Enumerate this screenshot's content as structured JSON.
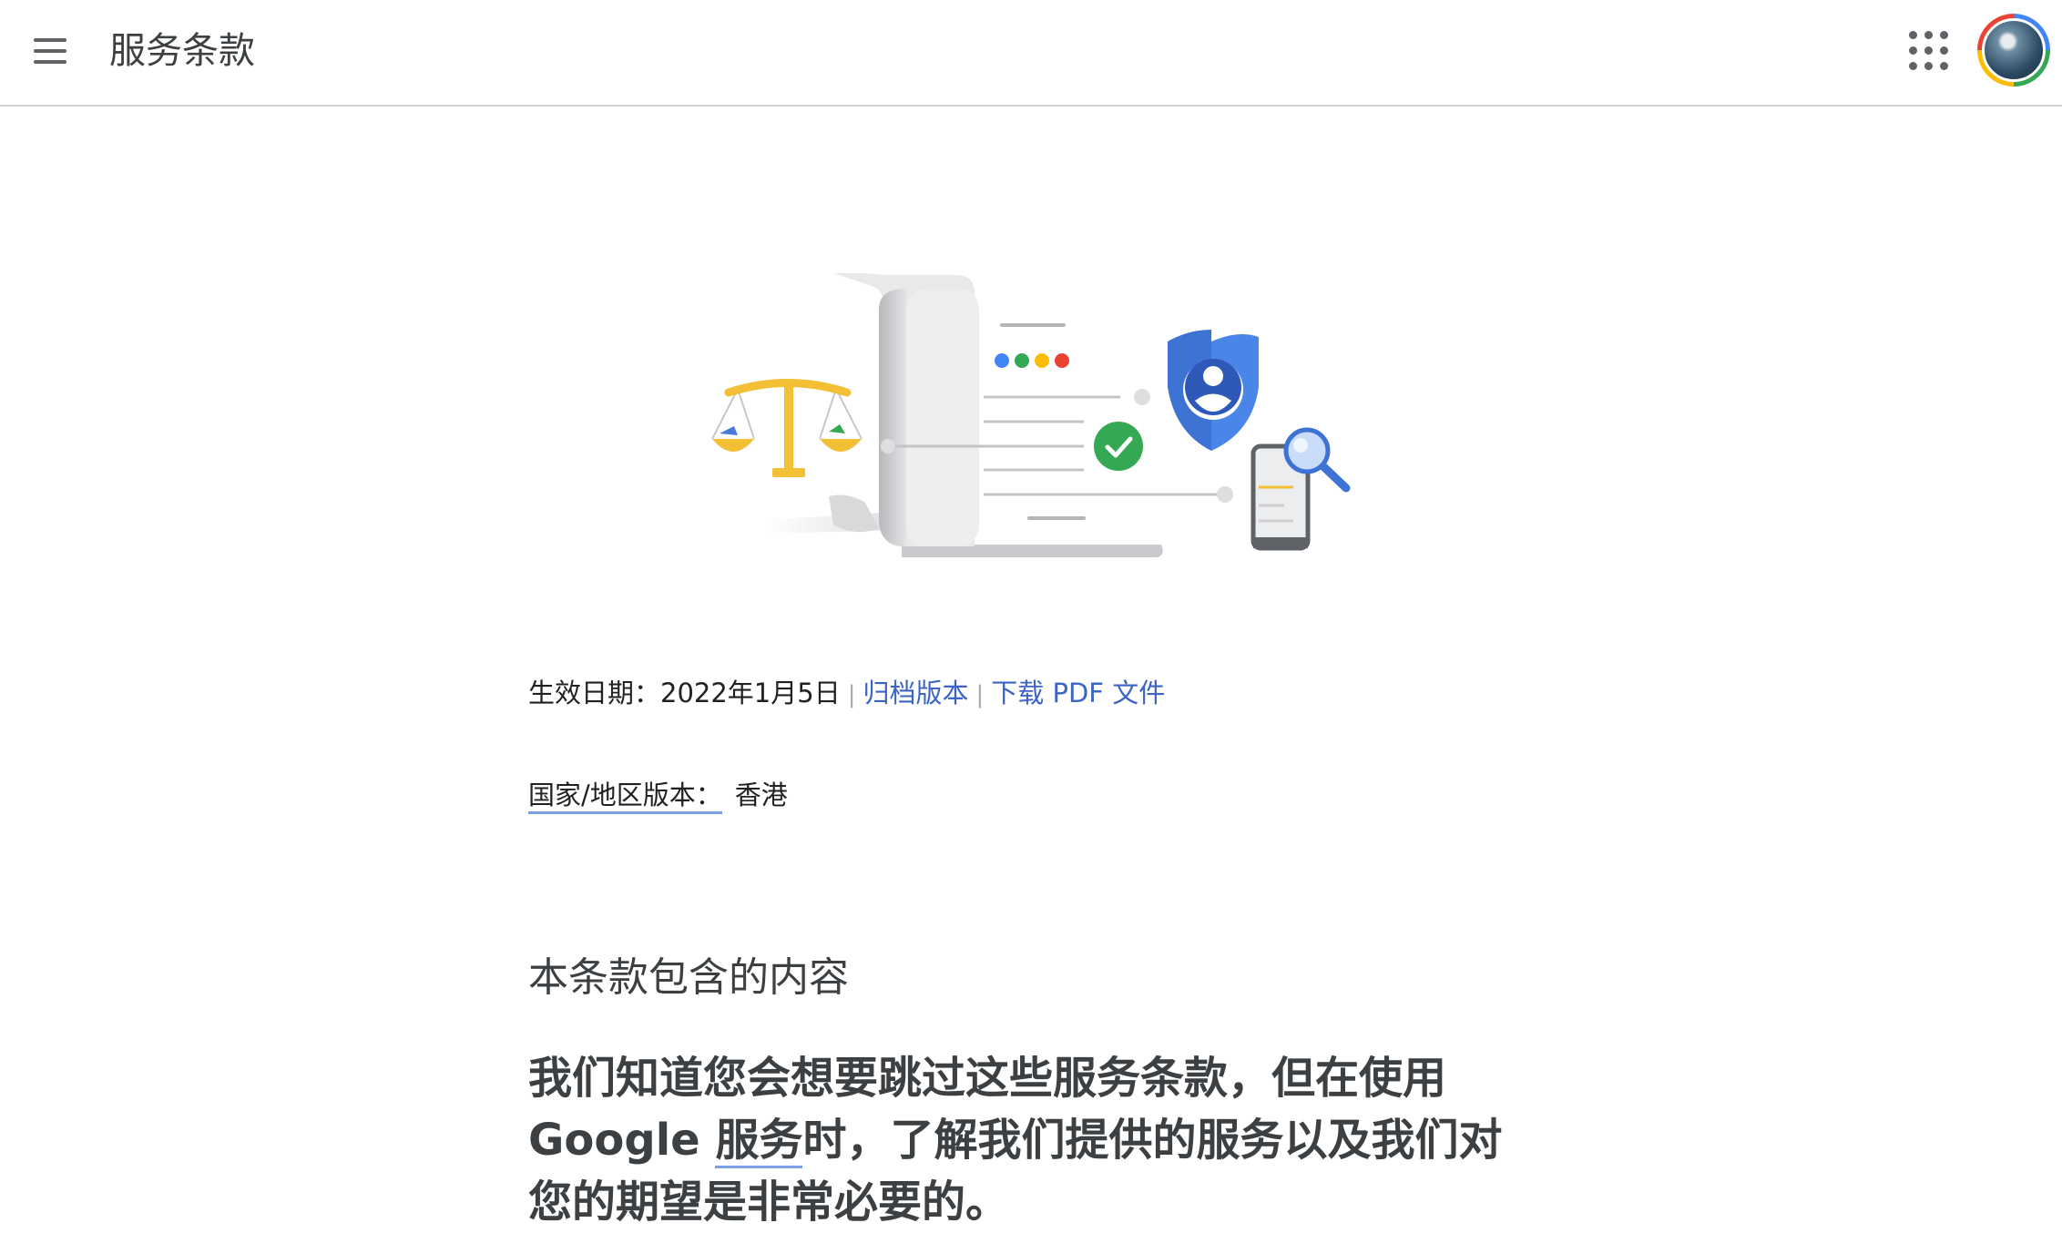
{
  "header": {
    "title": "服务条款",
    "menu_icon": "menu-icon",
    "apps_icon": "apps-grid-icon",
    "avatar": "account-avatar"
  },
  "hero": {
    "icons": [
      "scales-icon",
      "document-scroll-icon",
      "checkmark-icon",
      "shield-person-icon",
      "phone-search-icon"
    ],
    "brand_dot_colors": [
      "#4285f4",
      "#34a853",
      "#fbbc04",
      "#ea4335"
    ]
  },
  "meta": {
    "effective_date": "生效日期：2022年1月5日",
    "separator": "|",
    "archive_link": "归档版本",
    "pdf_link": "下载 PDF 文件"
  },
  "region": {
    "label": "国家/地区版本：",
    "value": "香港"
  },
  "content": {
    "section_title": "本条款包含的内容",
    "intro_part1": "我们知道您会想要跳过这些服务条款，但在使用",
    "intro_part2": "Google",
    "intro_link_term": "服务",
    "intro_part3": "时，了解我们提供的服务以及我们对",
    "intro_part4": "您的期望是非常必要的。"
  },
  "colors": {
    "link": "#3b64c4",
    "link_underline": "#7ca0e6",
    "text": "#202124"
  }
}
